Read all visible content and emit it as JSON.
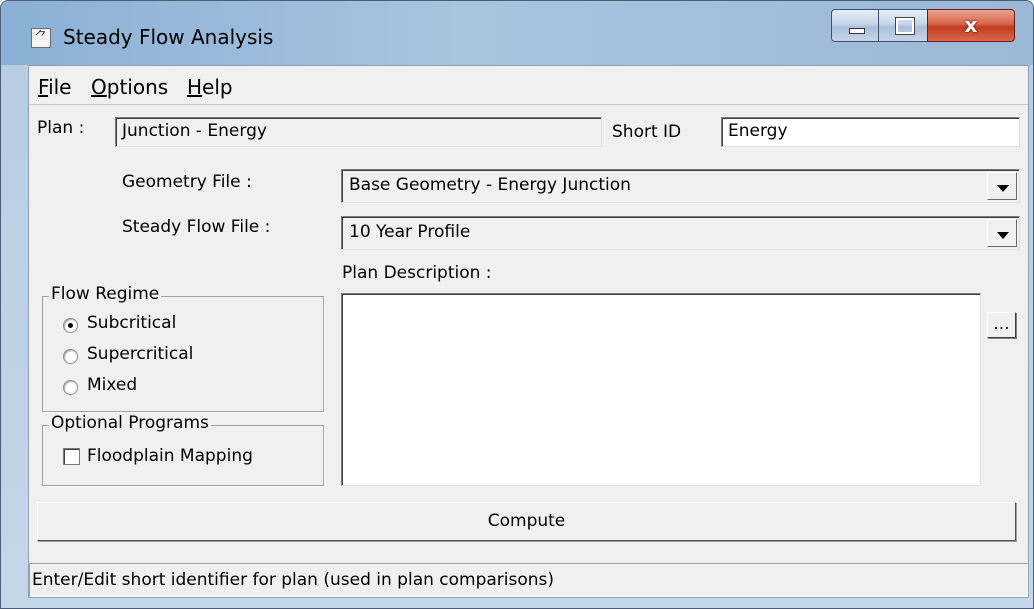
{
  "window": {
    "title": "Steady Flow Analysis",
    "close_glyph": "x"
  },
  "menu": [
    {
      "label": "File",
      "hotkey_index": 0
    },
    {
      "label": "Options",
      "hotkey_index": 0
    },
    {
      "label": "Help",
      "hotkey_index": 0
    }
  ],
  "plan": {
    "label": "Plan :",
    "value": "Junction - Energy",
    "short_id_label": "Short ID",
    "short_id_value": "Energy"
  },
  "geometry": {
    "label": "Geometry File :",
    "selected": "Base Geometry - Energy Junction"
  },
  "steady_flow": {
    "label": "Steady Flow File :",
    "selected": "10 Year Profile"
  },
  "plan_description": {
    "label": "Plan Description :",
    "value": "",
    "ellipsis_label": "..."
  },
  "flow_regime": {
    "legend": "Flow Regime",
    "options": [
      "Subcritical",
      "Supercritical",
      "Mixed"
    ],
    "selected": "Subcritical"
  },
  "optional_programs": {
    "legend": "Optional Programs",
    "floodplain_mapping_label": "Floodplain Mapping",
    "floodplain_mapping_checked": false
  },
  "compute_label": "Compute",
  "status_text": "Enter/Edit short identifier for plan (used in plan comparisons)"
}
